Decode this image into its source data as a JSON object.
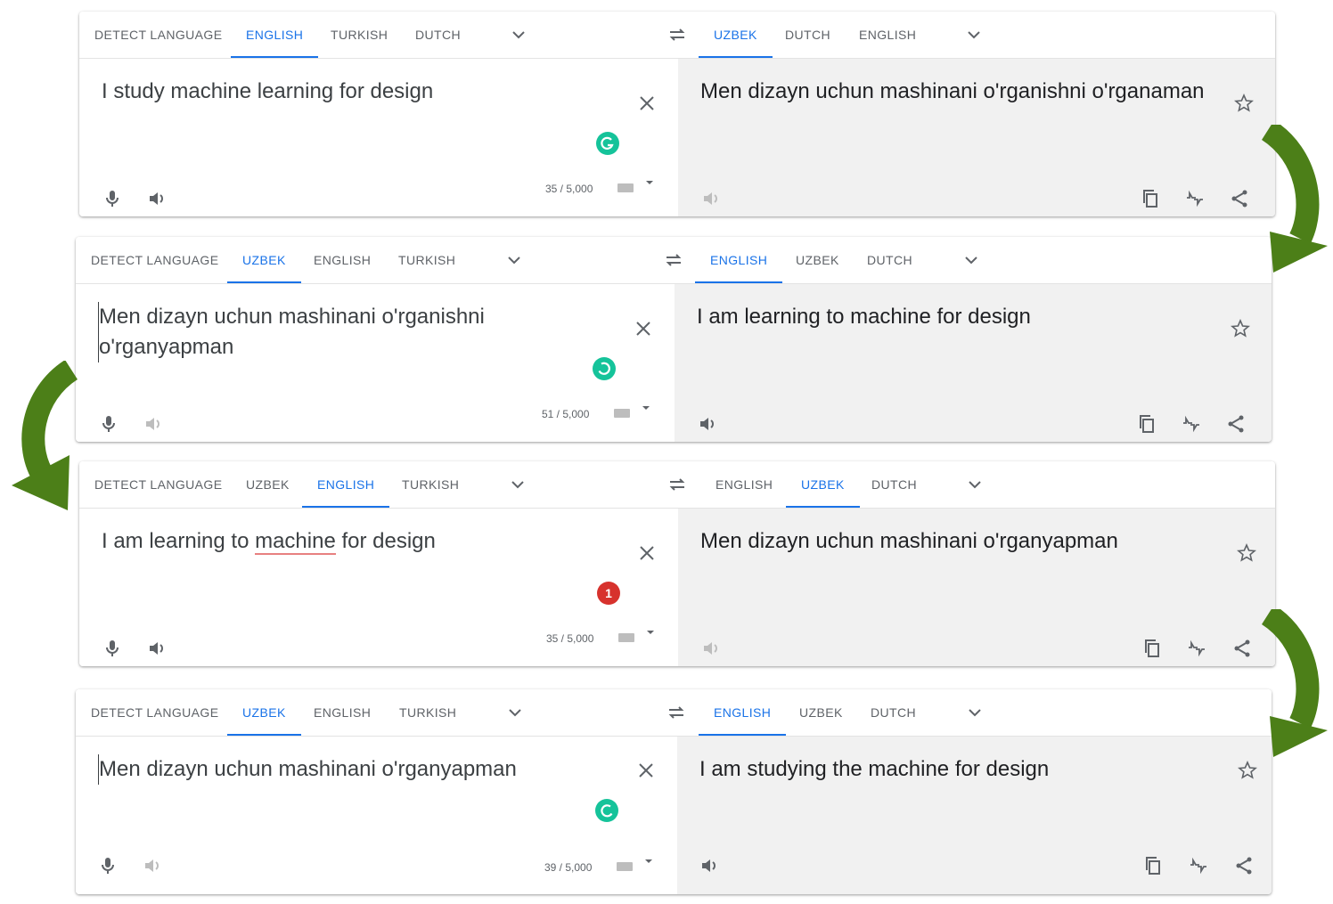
{
  "colors": {
    "accent": "#1a73e8",
    "tab_text": "#5f6368",
    "arrow": "#4c7f18",
    "grammarly": "#15c39a",
    "error_badge": "#d7322d"
  },
  "panels": [
    {
      "src_tabs": [
        "DETECT LANGUAGE",
        "ENGLISH",
        "TURKISH",
        "DUTCH"
      ],
      "src_active": 1,
      "tgt_tabs": [
        "UZBEK",
        "DUTCH",
        "ENGLISH"
      ],
      "tgt_active": 0,
      "source_text": "I study machine learning for design",
      "target_text": "Men dizayn uchun mashinani o'rganishni o'rganaman",
      "char_count": "35 / 5,000",
      "badge": "grammarly-check",
      "badge_text": ""
    },
    {
      "src_tabs": [
        "DETECT LANGUAGE",
        "UZBEK",
        "ENGLISH",
        "TURKISH"
      ],
      "src_active": 1,
      "tgt_tabs": [
        "ENGLISH",
        "UZBEK",
        "DUTCH"
      ],
      "tgt_active": 0,
      "source_text": "Men dizayn uchun mashinani o'rganishni o'rganyapman",
      "target_text": "I am learning to machine for design",
      "char_count": "51 / 5,000",
      "badge": "grammarly-loading",
      "badge_text": ""
    },
    {
      "src_tabs": [
        "DETECT LANGUAGE",
        "UZBEK",
        "ENGLISH",
        "TURKISH"
      ],
      "src_active": 2,
      "tgt_tabs": [
        "ENGLISH",
        "UZBEK",
        "DUTCH"
      ],
      "tgt_active": 1,
      "source_text_parts": [
        "I am learning to ",
        "machine",
        " for design"
      ],
      "target_text": "Men dizayn uchun mashinani o'rganyapman",
      "char_count": "35 / 5,000",
      "badge": "error-count",
      "badge_text": "1"
    },
    {
      "src_tabs": [
        "DETECT LANGUAGE",
        "UZBEK",
        "ENGLISH",
        "TURKISH"
      ],
      "src_active": 1,
      "tgt_tabs": [
        "ENGLISH",
        "UZBEK",
        "DUTCH"
      ],
      "tgt_active": 0,
      "source_text": "Men dizayn uchun mashinani o'rganyapman",
      "target_text": "I am studying the machine for design",
      "char_count": "39 / 5,000",
      "badge": "grammarly-loading",
      "badge_text": ""
    }
  ]
}
